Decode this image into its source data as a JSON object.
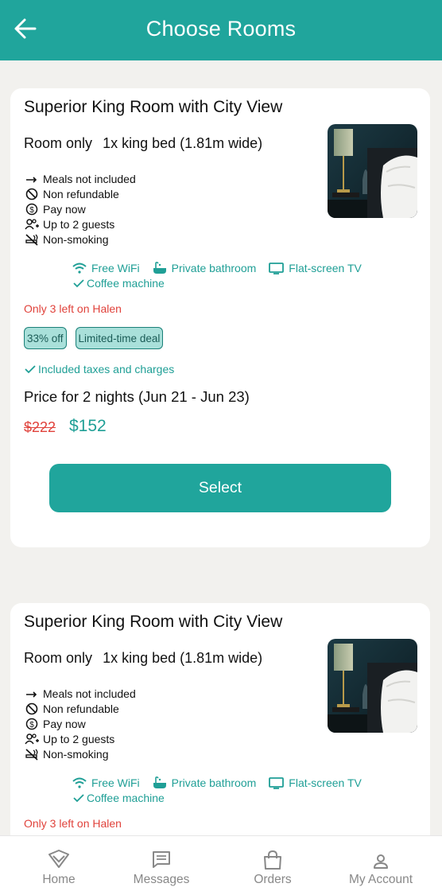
{
  "header": {
    "title": "Choose Rooms",
    "back_icon": "arrow-left-icon"
  },
  "rooms": [
    {
      "title": "Superior King Room with City View",
      "plan": "Room only",
      "bed": "1x king bed (1.81m wide)",
      "policies": [
        {
          "icon": "arrow-right-icon",
          "text": "Meals not included"
        },
        {
          "icon": "no-entry-icon",
          "text": "Non refundable"
        },
        {
          "icon": "dollar-coin-icon",
          "text": "Pay now"
        },
        {
          "icon": "guests-icon",
          "text": "Up to 2 guests"
        },
        {
          "icon": "no-smoking-icon",
          "text": "Non-smoking"
        }
      ],
      "amenities": [
        {
          "icon": "wifi-icon",
          "text": "Free WiFi"
        },
        {
          "icon": "bathtub-icon",
          "text": "Private bathroom"
        },
        {
          "icon": "tv-icon",
          "text": "Flat-screen TV"
        },
        {
          "icon": "check-icon",
          "text": "Coffee machine"
        }
      ],
      "availability": "Only 3 left on Halen",
      "badges": [
        "33% off",
        "Limited-time deal"
      ],
      "taxes": "Included taxes and charges",
      "price_for": "Price for 2 nights (Jun 21 - Jun 23)",
      "old_price": "$222",
      "new_price": "$152",
      "select_label": "Select"
    },
    {
      "title": "Superior King Room with City View",
      "plan": "Room only",
      "bed": "1x king bed (1.81m wide)",
      "policies": [
        {
          "icon": "arrow-right-icon",
          "text": "Meals not included"
        },
        {
          "icon": "no-entry-icon",
          "text": "Non refundable"
        },
        {
          "icon": "dollar-coin-icon",
          "text": "Pay now"
        },
        {
          "icon": "guests-icon",
          "text": "Up to 2 guests"
        },
        {
          "icon": "no-smoking-icon",
          "text": "Non-smoking"
        }
      ],
      "amenities": [
        {
          "icon": "wifi-icon",
          "text": "Free WiFi"
        },
        {
          "icon": "bathtub-icon",
          "text": "Private bathroom"
        },
        {
          "icon": "tv-icon",
          "text": "Flat-screen TV"
        },
        {
          "icon": "check-icon",
          "text": "Coffee machine"
        }
      ],
      "availability": "Only 3 left on Halen"
    }
  ],
  "tabbar": {
    "items": [
      {
        "icon": "home-logo-icon",
        "label": "Home"
      },
      {
        "icon": "message-icon",
        "label": "Messages"
      },
      {
        "icon": "shopping-bag-icon",
        "label": "Orders"
      },
      {
        "icon": "user-icon",
        "label": "My Account"
      }
    ]
  },
  "colors": {
    "primary": "#20a59c",
    "accent_text": "#1f9f96",
    "alert": "#e0423b",
    "badge_bg": "#a9e0da"
  }
}
